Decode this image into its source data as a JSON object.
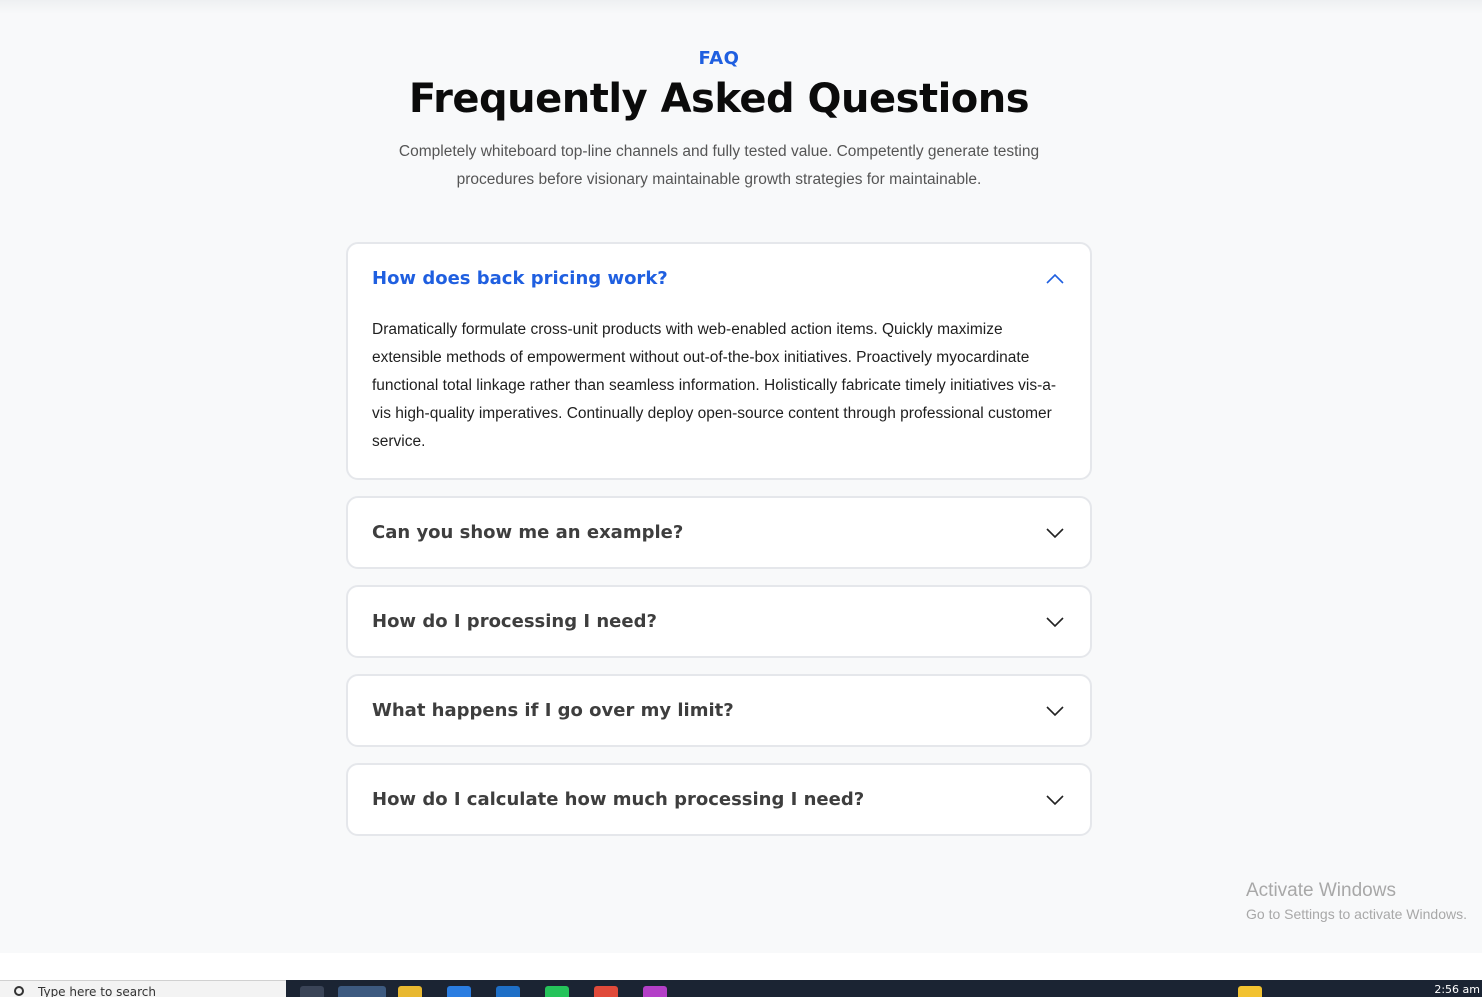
{
  "faq_section": {
    "eyebrow": "FAQ",
    "title": "Frequently Asked Questions",
    "subtitle_line1": "Completely whiteboard top-line channels and fully tested value. Competently generate testing",
    "subtitle_line2": "procedures before visionary maintainable growth strategies for maintainable.",
    "items": [
      {
        "question": "How does back pricing work?",
        "expanded": true,
        "answer": "Dramatically formulate cross-unit products with web-enabled action items. Quickly maximize extensible methods of empowerment without out-of-the-box initiatives. Proactively myocardinate functional total linkage rather than seamless information. Holistically fabricate timely initiatives vis-a-vis high-quality imperatives. Continually deploy open-source content through professional customer service."
      },
      {
        "question": "Can you show me an example?",
        "expanded": false
      },
      {
        "question": "How do I processing I need?",
        "expanded": false
      },
      {
        "question": "What happens if I go over my limit?",
        "expanded": false
      },
      {
        "question": "How do I calculate how much processing I need?",
        "expanded": false
      }
    ]
  },
  "os_overlay": {
    "watermark_title": "Activate Windows",
    "watermark_subtitle": "Go to Settings to activate Windows.",
    "taskbar_search_text": "Type here to search",
    "clock": "2:56 am"
  },
  "colors": {
    "accent": "#1f5fe0",
    "page_background": "#f8f9fa",
    "card_border": "#e5e7eb"
  },
  "icons": {
    "expanded": "chevron-up-icon",
    "collapsed": "chevron-down-icon"
  }
}
